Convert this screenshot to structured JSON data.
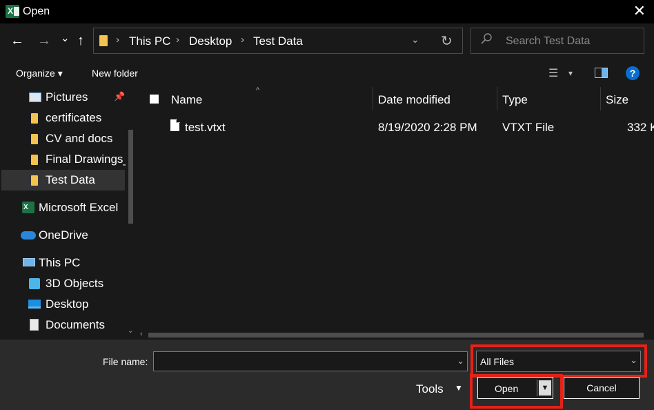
{
  "window": {
    "title": "Open",
    "close_glyph": "✕",
    "app_icon": "excel-icon",
    "app_icon_letter": "X"
  },
  "nav": {
    "back_glyph": "←",
    "forward_glyph": "→",
    "recent_glyph": "⌄",
    "up_glyph": "↑",
    "breadcrumbs": [
      "This PC",
      "Desktop",
      "Test Data"
    ],
    "separator": "›",
    "dropdown_glyph": "⌄",
    "refresh_glyph": "↻"
  },
  "search": {
    "placeholder": "Search Test Data"
  },
  "toolbar": {
    "organize": "Organize ▾",
    "new_folder": "New folder",
    "view_glyph": "☰",
    "view_dd": "▾",
    "help": "?"
  },
  "sidebar": {
    "items": [
      {
        "label": "Pictures",
        "icon": "pictures-icon",
        "pinned": true
      },
      {
        "label": "certificates",
        "icon": "folder-icon"
      },
      {
        "label": "CV and docs",
        "icon": "folder-icon"
      },
      {
        "label": "Final Drawings_",
        "icon": "folder-icon"
      },
      {
        "label": "Test Data",
        "icon": "folder-icon",
        "selected": true
      },
      {
        "label": "Microsoft Excel",
        "icon": "excel-icon"
      },
      {
        "label": "OneDrive",
        "icon": "onedrive-icon"
      },
      {
        "label": "This PC",
        "icon": "this-pc-icon"
      },
      {
        "label": "3D Objects",
        "icon": "3d-objects-icon"
      },
      {
        "label": "Desktop",
        "icon": "desktop-icon"
      },
      {
        "label": "Documents",
        "icon": "documents-icon"
      }
    ],
    "pin_glyph": "📌",
    "excel_letter": "X"
  },
  "filelist": {
    "columns": [
      "Name",
      "Date modified",
      "Type",
      "Size"
    ],
    "sort_glyph": "^",
    "rows": [
      {
        "name": "test.vtxt",
        "date": "8/19/2020 2:28 PM",
        "type": "VTXT File",
        "size": "332 K"
      }
    ],
    "hscroll_left": "‹"
  },
  "bottom": {
    "file_name_label": "File name:",
    "file_name_value": "",
    "filter_value": "All Files",
    "tools": "Tools",
    "tools_dd": "▼",
    "open": "Open",
    "open_arrow": "▼",
    "cancel": "Cancel",
    "dd_glyph": "⌄",
    "highlight_color": "#e32219"
  }
}
